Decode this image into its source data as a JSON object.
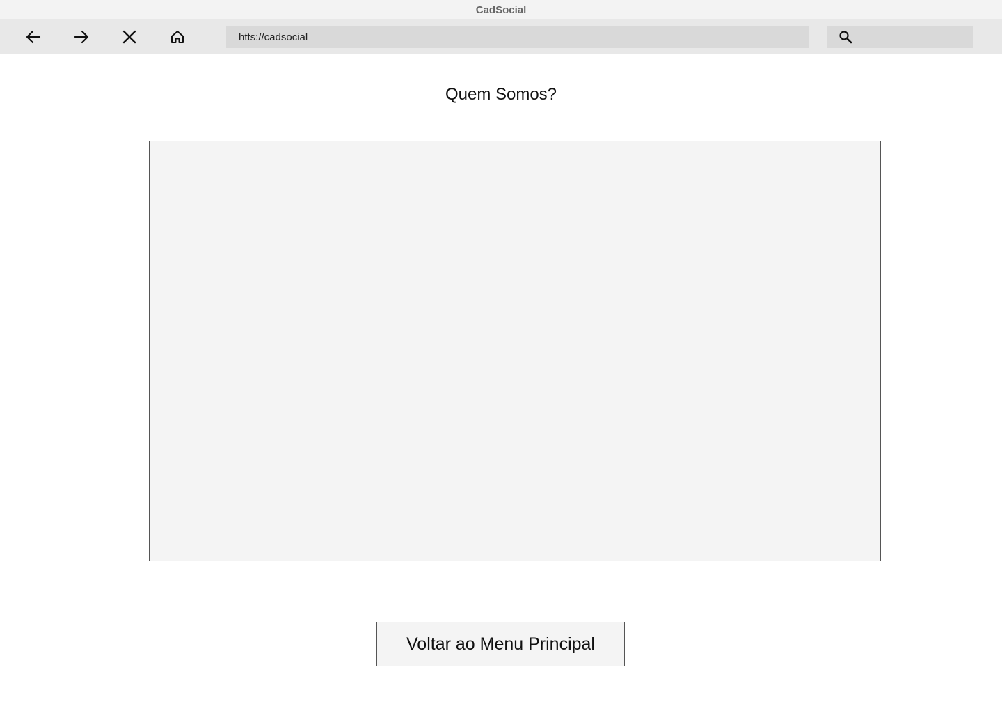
{
  "window": {
    "title": "CadSocial"
  },
  "toolbar": {
    "buttons": [
      {
        "name": "back",
        "icon": "arrow-left-icon"
      },
      {
        "name": "forward",
        "icon": "arrow-right-icon"
      },
      {
        "name": "stop",
        "icon": "close-icon"
      },
      {
        "name": "home",
        "icon": "home-icon"
      }
    ],
    "url": "htts://cadsocial",
    "search_icon": "search-icon"
  },
  "main": {
    "heading": "Quem Somos?",
    "back_button_label": "Voltar ao Menu Principal"
  },
  "colors": {
    "titlebar_bg": "#f3f3f3",
    "toolbar_bg": "#e8e8e8",
    "field_bg": "#d9d9d9",
    "panel_bg": "#f4f4f4",
    "border": "#555555"
  }
}
